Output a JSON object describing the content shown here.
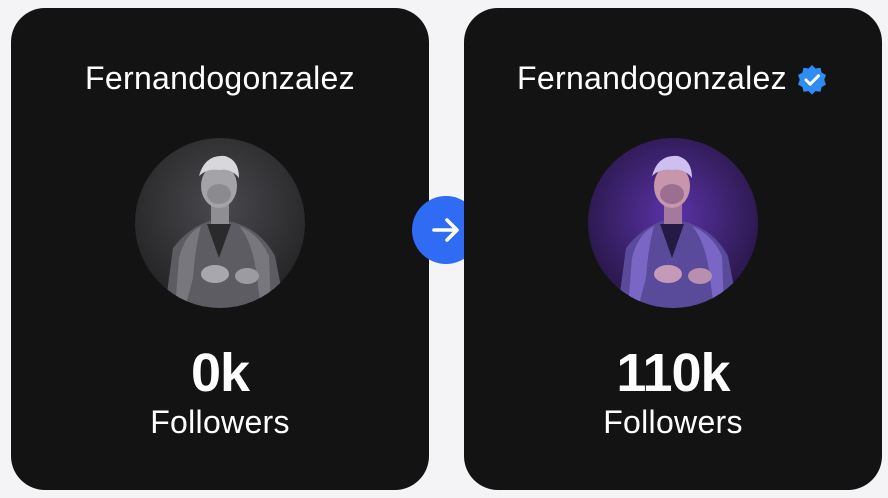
{
  "before": {
    "username": "Fernandogonzalez",
    "count": "0k",
    "label": "Followers"
  },
  "after": {
    "username": "Fernandogonzalez",
    "count": "110k",
    "label": "Followers",
    "verified": true
  },
  "icons": {
    "arrow": "arrow-right-icon",
    "verified": "verified-badge-icon"
  },
  "colors": {
    "card_bg": "#131313",
    "page_bg": "#f4f4f7",
    "accent": "#2f6bf3",
    "text": "#ffffff"
  }
}
